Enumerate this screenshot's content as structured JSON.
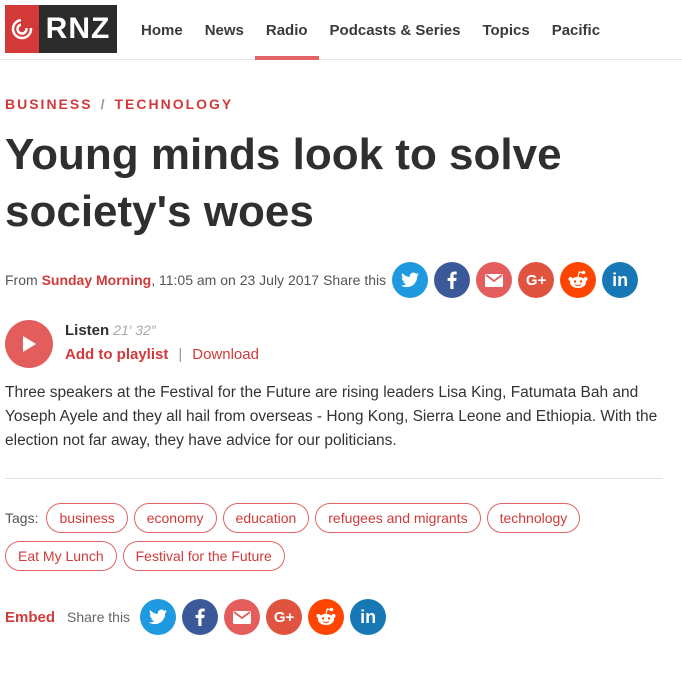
{
  "header": {
    "logo_text": "RNZ",
    "nav": [
      "Home",
      "News",
      "Radio",
      "Podcasts & Series",
      "Topics",
      "Pacific"
    ]
  },
  "article": {
    "breadcrumb": [
      "BUSINESS",
      "TECHNOLOGY"
    ],
    "title": "Young minds look to solve society's woes",
    "meta": {
      "from_label": "From",
      "programme": "Sunday Morning",
      "datetime": ", 11:05 am on 23 July 2017",
      "share_label": "Share this"
    },
    "player": {
      "listen_label": "Listen",
      "duration": "21′ 32″",
      "add_label": "Add to playlist",
      "separator": "|",
      "download_label": "Download"
    },
    "summary": "Three speakers at the Festival for the Future are rising leaders Lisa King, Fatumata Bah and Yoseph Ayele and they all hail from overseas - Hong Kong, Sierra Leone and Ethiopia. With the election not far away, they have advice for our politicians.",
    "tags_label": "Tags:",
    "tags": [
      "business",
      "economy",
      "education",
      "refugees and migrants",
      "technology",
      "Eat My Lunch",
      "Festival for the Future"
    ],
    "footer": {
      "embed_label": "Embed",
      "share_label": "Share this"
    }
  },
  "share_icons": [
    "twitter-icon",
    "facebook-icon",
    "email-icon",
    "google-plus-icon",
    "reddit-icon",
    "linkedin-icon"
  ],
  "colors": {
    "accent": "#d13a3a",
    "twitter": "#1f9ae0",
    "facebook": "#3b5998",
    "email": "#e35d5d",
    "gplus": "#e0533e",
    "reddit": "#ff4500",
    "linkedin": "#1878b5"
  }
}
